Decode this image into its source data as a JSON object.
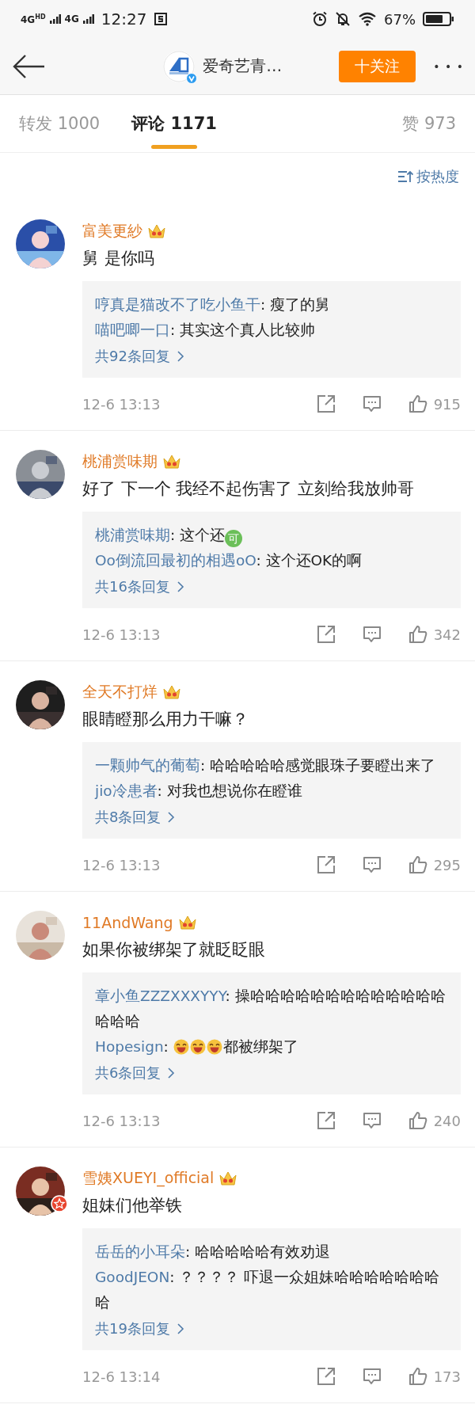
{
  "status_bar": {
    "network_1": "4G",
    "network_1_sup": "HD",
    "network_2": "4G",
    "time": "12:27",
    "battery": "67%"
  },
  "nav": {
    "title": "爱奇艺青…",
    "verified": true,
    "follow_button": "十关注",
    "more": "• • •"
  },
  "tabs": [
    {
      "label": "转发 1000",
      "selected": false
    },
    {
      "label": "评论 1171",
      "selected": true
    }
  ],
  "likes_tab": {
    "label": "赞 973"
  },
  "sort": {
    "label": "按热度"
  },
  "comments": [
    {
      "user": "富美更紗",
      "official": false,
      "text": "舅 是你吗",
      "replies": [
        {
          "user": "哼真是猫改不了吃小鱼干",
          "parts": [
            {
              "kind": "text",
              "text": ": 瘦了的舅"
            }
          ]
        },
        {
          "user": "喵吧唧一口",
          "parts": [
            {
              "kind": "text",
              "text": ": 其实这个真人比较帅"
            }
          ]
        }
      ],
      "more": "共92条回复",
      "time": "12-6 13:13",
      "likes": "915"
    },
    {
      "user": "桃浦赏味期",
      "official": false,
      "text": "好了 下一个 我经不起伤害了 立刻给我放帅哥",
      "replies": [
        {
          "user": "桃浦赏味期",
          "parts": [
            {
              "kind": "text",
              "text": ": 这个还"
            },
            {
              "kind": "badge",
              "text": "可"
            }
          ]
        },
        {
          "user": "Oo倒流回最初的相遇oO",
          "parts": [
            {
              "kind": "text",
              "text": ": 这个还OK的啊"
            }
          ]
        }
      ],
      "more": "共16条回复",
      "time": "12-6 13:13",
      "likes": "342"
    },
    {
      "user": "全天不打烊",
      "official": false,
      "text": "眼睛瞪那么用力干嘛？",
      "replies": [
        {
          "user": "一颗帅气的葡萄",
          "parts": [
            {
              "kind": "text",
              "text": ": 哈哈哈哈哈感觉眼珠子要瞪出来了"
            }
          ]
        },
        {
          "user": "jio冷患者",
          "parts": [
            {
              "kind": "text",
              "text": ": 对我也想说你在瞪谁"
            }
          ]
        }
      ],
      "more": "共8条回复",
      "time": "12-6 13:13",
      "likes": "295"
    },
    {
      "user": "11AndWang",
      "official": false,
      "text": "如果你被绑架了就眨眨眼",
      "replies": [
        {
          "user": "章小鱼ZZZXXXYYY",
          "parts": [
            {
              "kind": "text",
              "text": ": 操哈哈哈哈哈哈哈哈哈哈哈哈哈哈哈哈"
            }
          ]
        },
        {
          "user": "Hopesign",
          "parts": [
            {
              "kind": "text",
              "text": ": "
            },
            {
              "kind": "laugh"
            },
            {
              "kind": "laugh"
            },
            {
              "kind": "laugh"
            },
            {
              "kind": "text",
              "text": "都被绑架了"
            }
          ]
        }
      ],
      "more": "共6条回复",
      "time": "12-6 13:13",
      "likes": "240"
    },
    {
      "user": "雪姨XUEYI_official",
      "official": true,
      "text": "姐妹们他举铁",
      "replies": [
        {
          "user": "岳岳的小耳朵",
          "parts": [
            {
              "kind": "text",
              "text": ": 哈哈哈哈哈有效劝退"
            }
          ]
        },
        {
          "user": "GoodJEON",
          "parts": [
            {
              "kind": "text",
              "text": ": ？？？？ 吓退一众姐妹哈哈哈哈哈哈哈哈"
            }
          ]
        }
      ],
      "more": "共19条回复",
      "time": "12-6 13:14",
      "likes": "173"
    }
  ]
}
